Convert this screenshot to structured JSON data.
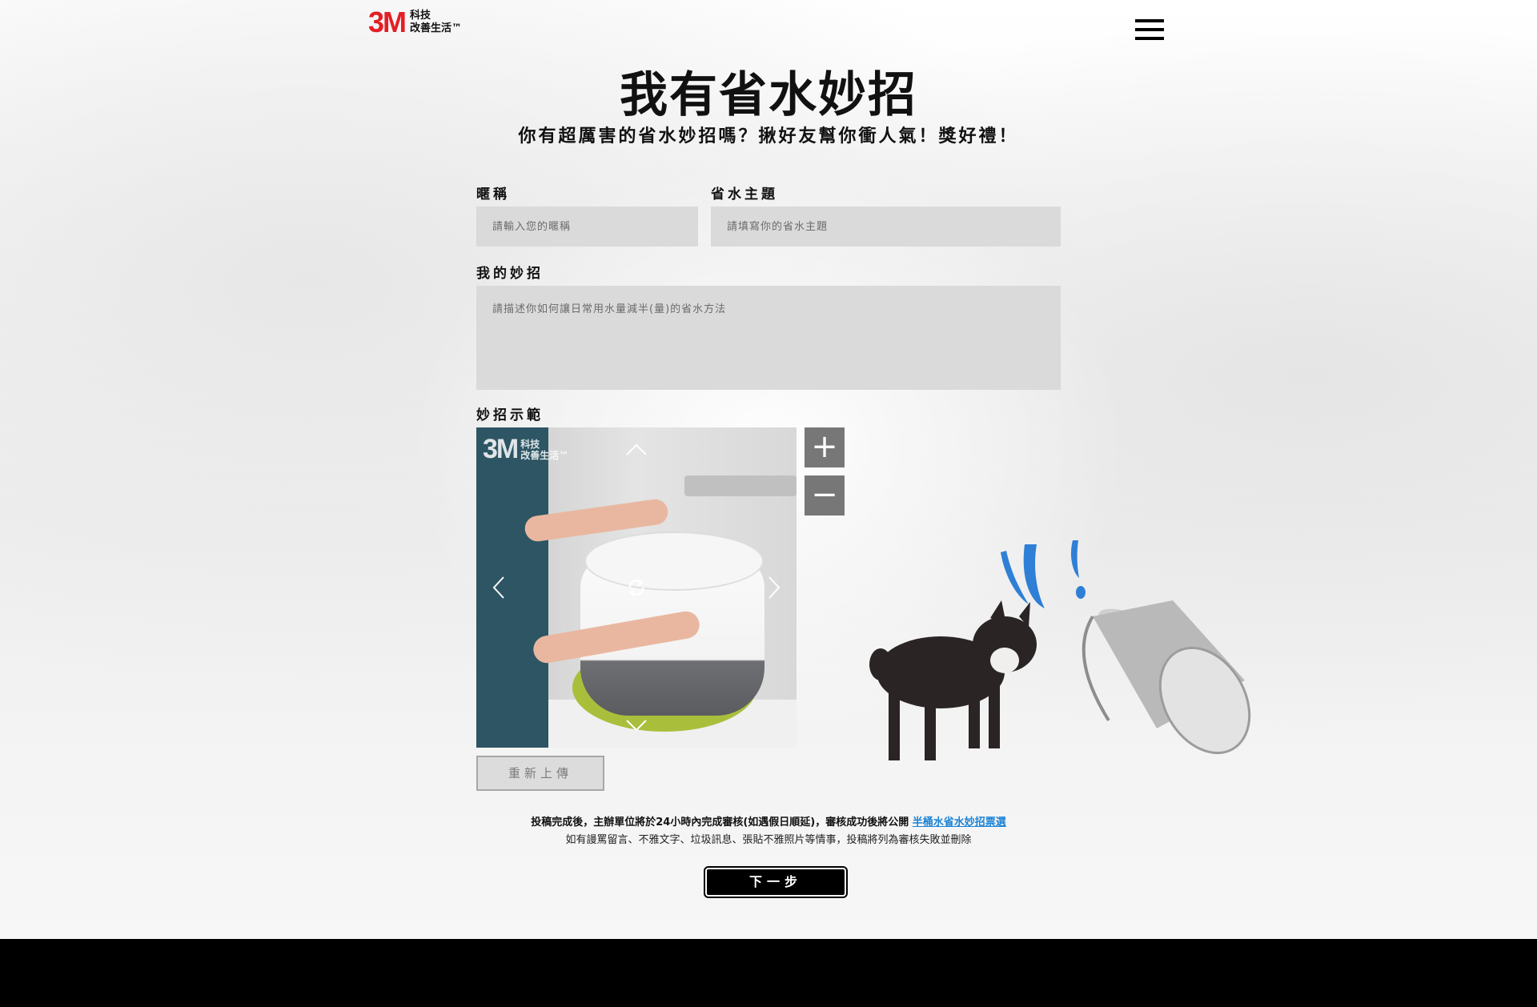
{
  "header": {
    "logo_mark": "3M",
    "logo_line1": "科技",
    "logo_line2": "改善生活™",
    "menu_icon": "hamburger-icon"
  },
  "page": {
    "title": "我有省水妙招",
    "subtitle": "你有超厲害的省水妙招嗎？揪好友幫你衝人氣！獎好禮！"
  },
  "form": {
    "nickname_label": "暱稱",
    "nickname_placeholder": "請輸入您的暱稱",
    "theme_label": "省水主題",
    "theme_placeholder": "請填寫你的省水主題",
    "tip_label": "我的妙招",
    "tip_placeholder": "請描述你如何讓日常用水量減半(量)的省水方法",
    "demo_label": "妙招示範",
    "reupload_label": "重新上傳"
  },
  "preview": {
    "watermark_mark": "3M",
    "watermark_line1": "科技",
    "watermark_line2": "改善生活™",
    "controls": [
      "chevron-up-icon",
      "chevron-down-icon",
      "chevron-left-icon",
      "chevron-right-icon",
      "rotate-icon"
    ],
    "zoom_in_label": "+",
    "zoom_out_label": "−"
  },
  "notes": {
    "line1_prefix": "投稿完成後，主辦單位將於24小時內完成審核(如遇假日順延)，審核成功後將公開",
    "line1_link": "半桶水省水妙招票選",
    "line2": "如有謾罵留言、不雅文字、垃圾訊息、張貼不雅照片等情事，投稿將列為審核失敗並刪除"
  },
  "actions": {
    "next_label": "下一步"
  },
  "colors": {
    "brand_red": "#e41e26",
    "link_blue": "#1a82d6",
    "water_blue": "#2f7fd6",
    "footer": "#000000"
  }
}
